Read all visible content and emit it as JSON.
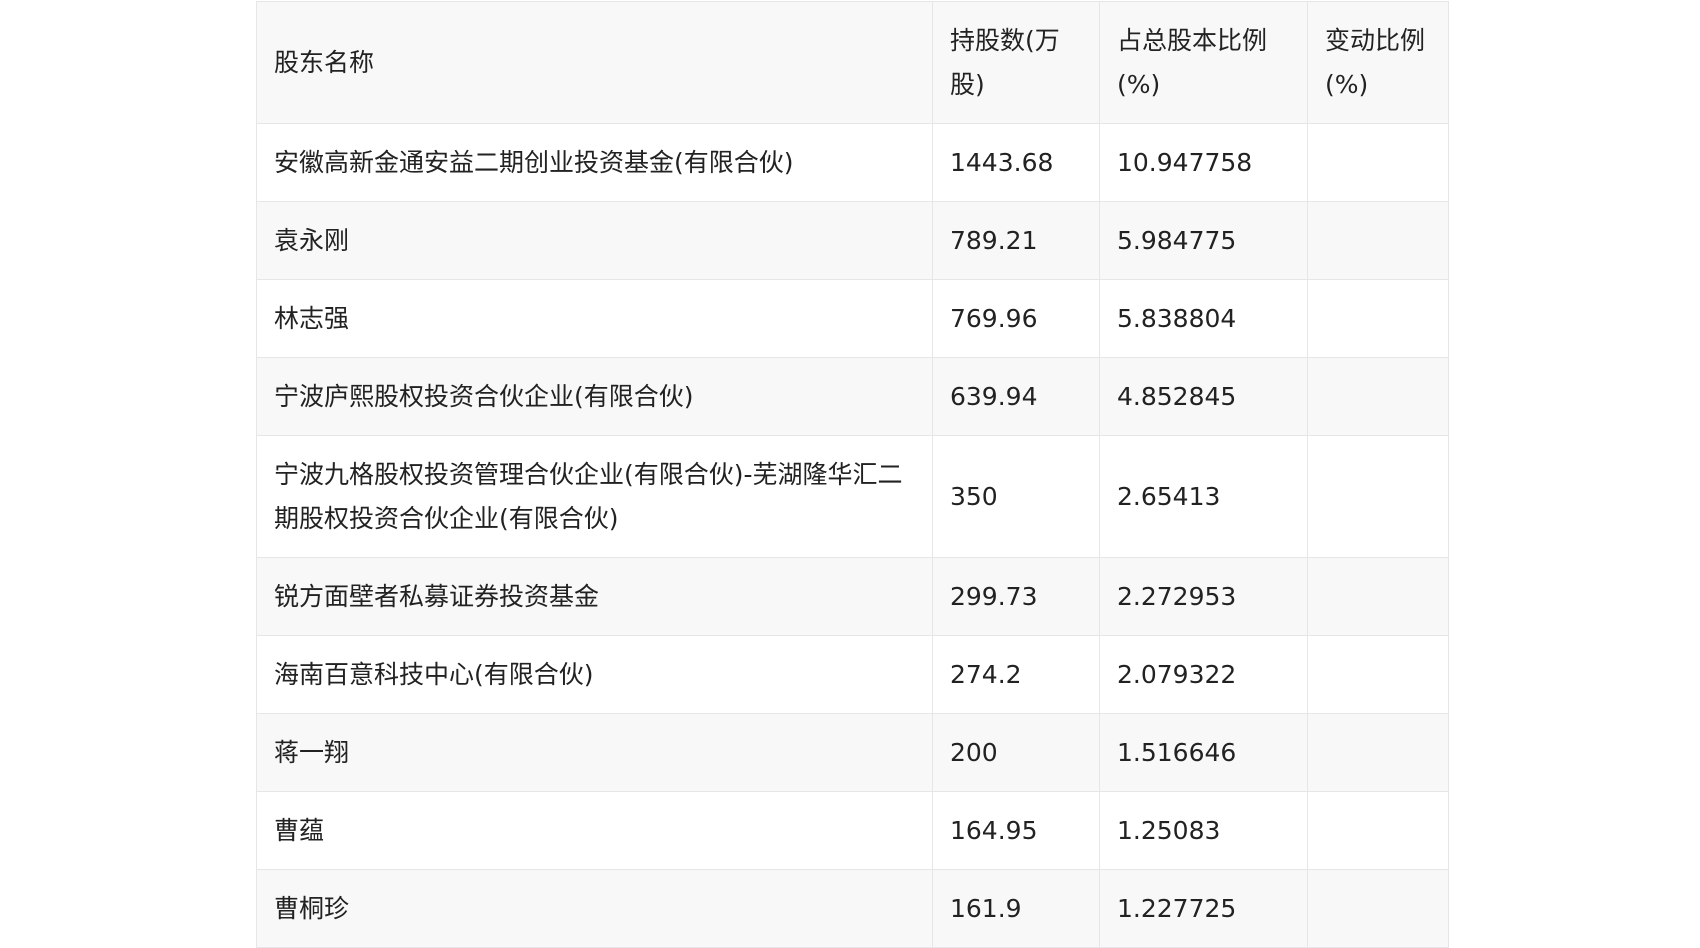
{
  "table": {
    "headers": [
      "股东名称",
      "持股数(万股)",
      "占总股本比例(%)",
      "变动比例(%)"
    ],
    "rows": [
      {
        "name": "安徽高新金通安益二期创业投资基金(有限合伙)",
        "shares": "1443.68",
        "ratio": "10.947758",
        "change": ""
      },
      {
        "name": "袁永刚",
        "shares": "789.21",
        "ratio": "5.984775",
        "change": ""
      },
      {
        "name": "林志强",
        "shares": "769.96",
        "ratio": "5.838804",
        "change": ""
      },
      {
        "name": "宁波庐熙股权投资合伙企业(有限合伙)",
        "shares": "639.94",
        "ratio": "4.852845",
        "change": ""
      },
      {
        "name": "宁波九格股权投资管理合伙企业(有限合伙)-芜湖隆华汇二期股权投资合伙企业(有限合伙)",
        "shares": "350",
        "ratio": "2.65413",
        "change": ""
      },
      {
        "name": "锐方面壁者私募证券投资基金",
        "shares": "299.73",
        "ratio": "2.272953",
        "change": ""
      },
      {
        "name": "海南百意科技中心(有限合伙)",
        "shares": "274.2",
        "ratio": "2.079322",
        "change": ""
      },
      {
        "name": "蒋一翔",
        "shares": "200",
        "ratio": "1.516646",
        "change": ""
      },
      {
        "name": "曹蕴",
        "shares": "164.95",
        "ratio": "1.25083",
        "change": ""
      },
      {
        "name": "曹桐珍",
        "shares": "161.9",
        "ratio": "1.227725",
        "change": ""
      }
    ]
  }
}
